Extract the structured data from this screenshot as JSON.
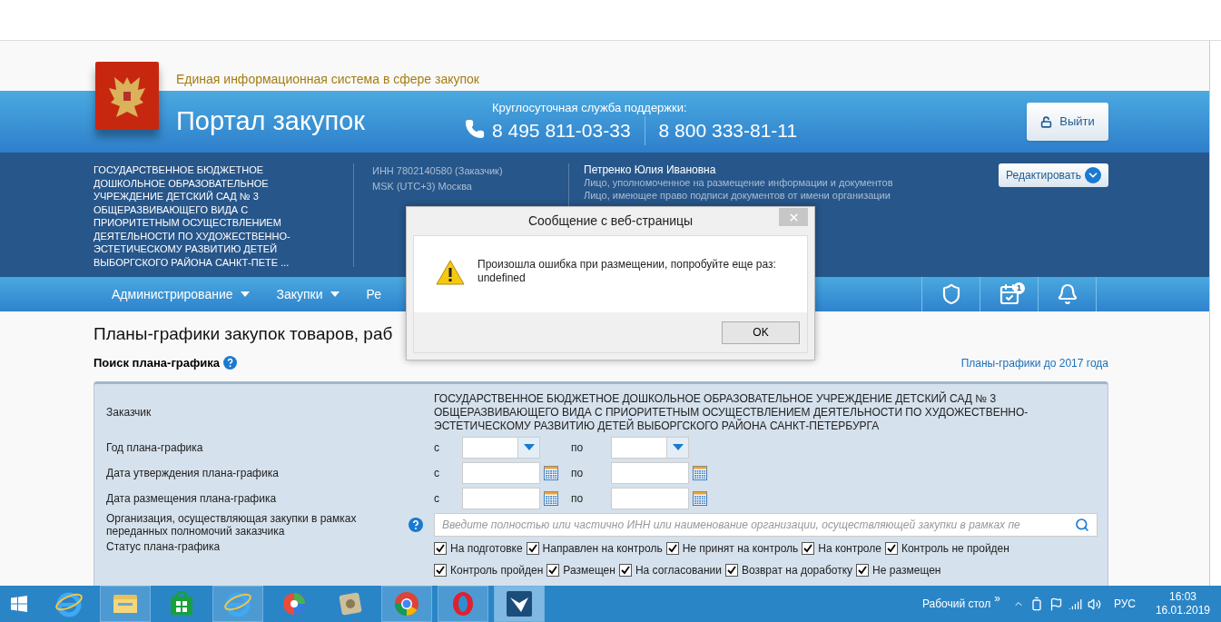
{
  "header": {
    "tagline": "Единая информационная система в сфере закупок",
    "title": "Портал закупок",
    "support_label": "Круглосуточная служба поддержки:",
    "phones": [
      "8 495 811-03-33",
      "8 800 333-81-11"
    ],
    "logout_button": "Выйти"
  },
  "organization": {
    "name": "ГОСУДАРСТВЕННОЕ БЮДЖЕТНОЕ ДОШКОЛЬНОЕ ОБРАЗОВАТЕЛЬНОЕ УЧРЕЖДЕНИЕ ДЕТСКИЙ САД № 3 ОБЩЕРАЗВИВАЮЩЕГО ВИДА С ПРИОРИТЕТНЫМ ОСУЩЕСТВЛЕНИЕМ ДЕЯТЕЛЬНОСТИ ПО ХУДОЖЕСТВЕННО-ЭСТЕТИЧЕСКОМУ РАЗВИТИЮ ДЕТЕЙ ВЫБОРГСКОГО РАЙОНА САНКТ-ПЕТЕ ...",
    "inn": "ИНН 7802140580 (Заказчик)",
    "timezone": "MSK (UTC+3) Москва",
    "user_name": "Петренко Юлия Ивановна",
    "roles": [
      "Лицо, уполномоченное на размещение информации и документов",
      "Лицо, имеющее право подписи документов от имени организации"
    ],
    "edit_button": "Редактировать"
  },
  "nav": {
    "items": [
      {
        "label": "Администрирование",
        "dropdown": true
      },
      {
        "label": "Закупки",
        "dropdown": true
      },
      {
        "label": "Ре",
        "dropdown": false
      }
    ],
    "icons": [
      {
        "kind": "shield"
      },
      {
        "kind": "calendar",
        "badge": "1"
      },
      {
        "kind": "bell"
      }
    ]
  },
  "page": {
    "title": "Планы-графики закупок товаров, раб",
    "search_title": "Поиск плана-графика",
    "archive_link": "Планы-графики до 2017 года",
    "rows": [
      {
        "kind": "text",
        "label": "Заказчик",
        "value": "ГОСУДАРСТВЕННОЕ БЮДЖЕТНОЕ ДОШКОЛЬНОЕ ОБРАЗОВАТЕЛЬНОЕ УЧРЕЖДЕНИЕ ДЕТСКИЙ САД № 3 ОБЩЕРАЗВИВАЮЩЕГО ВИДА С ПРИОРИТЕТНЫМ ОСУЩЕСТВЛЕНИЕМ ДЕЯТЕЛЬНОСТИ ПО ХУДОЖЕСТВЕННО-ЭСТЕТИЧЕСКОМУ РАЗВИТИЮ ДЕТЕЙ ВЫБОРГСКОГО РАЙОНА САНКТ-ПЕТЕРБУРГА"
      },
      {
        "kind": "select_range",
        "label": "Год плана-графика",
        "from": "с",
        "to": "по"
      },
      {
        "kind": "date_range",
        "label": "Дата утверждения плана-графика",
        "from": "с",
        "to": "по"
      },
      {
        "kind": "date_range",
        "label": "Дата размещения плана-графика",
        "from": "с",
        "to": "по"
      },
      {
        "kind": "search",
        "label": "Организация, осуществляющая закупки в рамках переданных полномочий заказчика",
        "placeholder": "Введите полностью или частично ИНН или наименование организации, осуществляющей закупки в рамках пе"
      },
      {
        "kind": "checkboxes",
        "label": "Статус плана-графика",
        "lines": [
          [
            {
              "label": "На подготовке",
              "checked": true
            },
            {
              "label": "Направлен на контроль",
              "checked": true
            },
            {
              "label": "Не принят на контроль",
              "checked": true
            },
            {
              "label": "На контроле",
              "checked": true
            },
            {
              "label": "Контроль не пройден",
              "checked": true
            }
          ],
          [
            {
              "label": "Контроль пройден",
              "checked": true
            },
            {
              "label": "Размещен",
              "checked": true
            },
            {
              "label": "На согласовании",
              "checked": true
            },
            {
              "label": "Возврат на доработку",
              "checked": true
            },
            {
              "label": "Не размещен",
              "checked": true
            }
          ]
        ]
      }
    ]
  },
  "dialog": {
    "title": "Сообщение с веб-страницы",
    "message": "Произошла ошибка при размещении, попробуйте еще раз:\nundefined",
    "ok_button": "OK"
  },
  "taskbar": {
    "apps": [
      {
        "kind": "ie",
        "running": false,
        "selected": false
      },
      {
        "kind": "folder",
        "running": true,
        "selected": false
      },
      {
        "kind": "store",
        "running": false,
        "selected": false
      },
      {
        "kind": "ie",
        "running": true,
        "selected": false
      },
      {
        "kind": "disc",
        "running": false,
        "selected": false
      },
      {
        "kind": "scroll",
        "running": false,
        "selected": false
      },
      {
        "kind": "chrome",
        "running": true,
        "selected": false
      },
      {
        "kind": "opera",
        "running": true,
        "selected": false
      },
      {
        "kind": "bird",
        "running": true,
        "selected": true
      }
    ],
    "desktop_label": "Рабочий стол",
    "more": "»",
    "language": "РУС",
    "time": "16:03",
    "date": "16.01.2019"
  }
}
